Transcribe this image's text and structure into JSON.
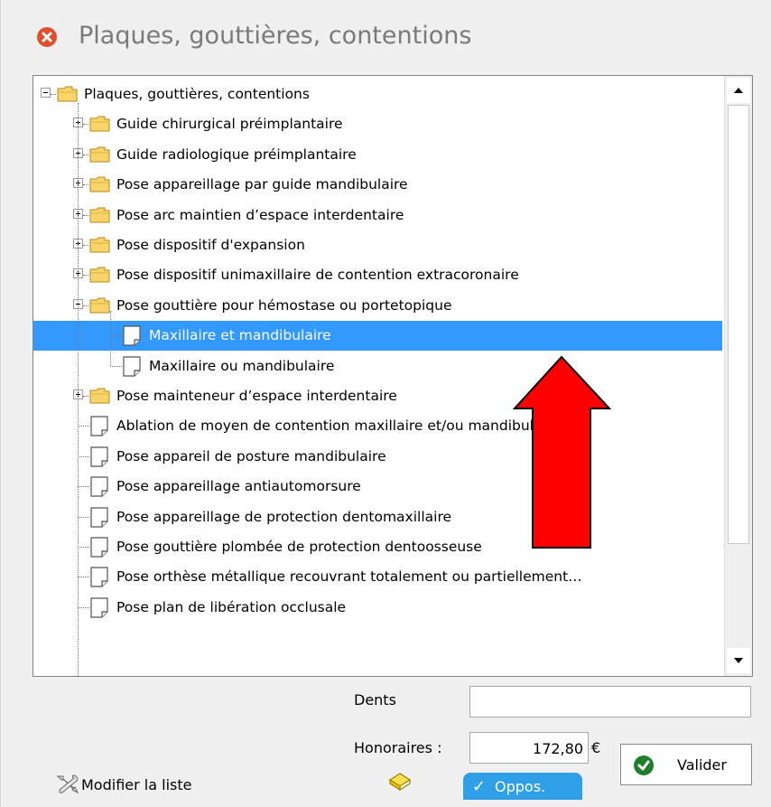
{
  "window": {
    "title": "Plaques, gouttières, contentions",
    "close_icon": "close-icon"
  },
  "tree": {
    "rows": [
      {
        "label": "Plaques, gouttières, contentions",
        "type": "folder",
        "level": 0,
        "expander": "minus"
      },
      {
        "label": "Guide chirurgical préimplantaire",
        "type": "folder",
        "level": 1,
        "expander": "plus"
      },
      {
        "label": "Guide radiologique préimplantaire",
        "type": "folder",
        "level": 1,
        "expander": "plus"
      },
      {
        "label": "Pose appareillage par guide mandibulaire",
        "type": "folder",
        "level": 1,
        "expander": "plus"
      },
      {
        "label": "Pose arc maintien d’espace interdentaire",
        "type": "folder",
        "level": 1,
        "expander": "plus"
      },
      {
        "label": "Pose dispositif d'expansion",
        "type": "folder",
        "level": 1,
        "expander": "plus"
      },
      {
        "label": "Pose dispositif unimaxillaire de contention extracoronaire",
        "type": "folder",
        "level": 1,
        "expander": "plus"
      },
      {
        "label": "Pose gouttière pour hémostase ou portetopique",
        "type": "folder",
        "level": 1,
        "expander": "minus"
      },
      {
        "label": "Maxillaire et mandibulaire",
        "type": "doc",
        "level": 2,
        "selected": true
      },
      {
        "label": "Maxillaire ou mandibulaire",
        "type": "doc",
        "level": 2
      },
      {
        "label": "Pose mainteneur d’espace interdentaire",
        "type": "folder",
        "level": 1,
        "expander": "plus"
      },
      {
        "label": "Ablation de moyen de contention maxillaire et/ou mandibulaire",
        "type": "doc",
        "level": 1
      },
      {
        "label": "Pose appareil de posture mandibulaire",
        "type": "doc",
        "level": 1
      },
      {
        "label": "Pose appareillage antiautomorsure",
        "type": "doc",
        "level": 1
      },
      {
        "label": "Pose appareillage de protection dentomaxillaire",
        "type": "doc",
        "level": 1
      },
      {
        "label": "Pose gouttière plombée de protection dentoosseuse",
        "type": "doc",
        "level": 1
      },
      {
        "label": "Pose orthèse métallique recouvrant totalement ou partiellement…",
        "type": "doc",
        "level": 1
      },
      {
        "label": "Pose plan de libération occlusale",
        "type": "doc",
        "level": 1
      }
    ]
  },
  "form": {
    "dents_label": "Dents",
    "dents_value": "",
    "honoraires_label": "Honoraires :",
    "honoraires_value": "172,80",
    "currency": "€"
  },
  "buttons": {
    "valider": "Valider",
    "modifier_liste": "Modifier la liste",
    "oppos": "Oppos.",
    "oppos_check": "✓"
  },
  "colors": {
    "selection": "#3399ff",
    "annotation_arrow": "#ff0000",
    "oppos_bg": "#2f9fe7",
    "close_red": "#e04e2c"
  }
}
